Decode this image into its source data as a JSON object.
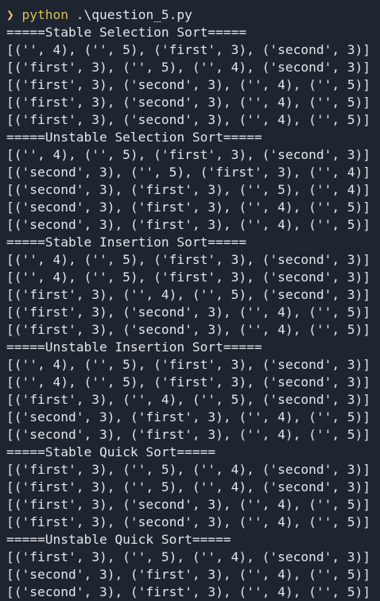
{
  "terminal": {
    "prompt": {
      "symbol": "❯",
      "command": "python",
      "argument": ".\\question_5.py"
    },
    "lines": [
      "=====Stable Selection Sort=====",
      "[('', 4), ('', 5), ('first', 3), ('second', 3)]",
      "[('first', 3), ('', 5), ('', 4), ('second', 3)]",
      "[('first', 3), ('second', 3), ('', 4), ('', 5)]",
      "[('first', 3), ('second', 3), ('', 4), ('', 5)]",
      "[('first', 3), ('second', 3), ('', 4), ('', 5)]",
      "=====Unstable Selection Sort=====",
      "[('', 4), ('', 5), ('first', 3), ('second', 3)]",
      "[('second', 3), ('', 5), ('first', 3), ('', 4)]",
      "[('second', 3), ('first', 3), ('', 5), ('', 4)]",
      "[('second', 3), ('first', 3), ('', 4), ('', 5)]",
      "[('second', 3), ('first', 3), ('', 4), ('', 5)]",
      "=====Stable Insertion Sort=====",
      "[('', 4), ('', 5), ('first', 3), ('second', 3)]",
      "[('', 4), ('', 5), ('first', 3), ('second', 3)]",
      "[('first', 3), ('', 4), ('', 5), ('second', 3)]",
      "[('first', 3), ('second', 3), ('', 4), ('', 5)]",
      "[('first', 3), ('second', 3), ('', 4), ('', 5)]",
      "=====Unstable Insertion Sort=====",
      "[('', 4), ('', 5), ('first', 3), ('second', 3)]",
      "[('', 4), ('', 5), ('first', 3), ('second', 3)]",
      "[('first', 3), ('', 4), ('', 5), ('second', 3)]",
      "[('second', 3), ('first', 3), ('', 4), ('', 5)]",
      "[('second', 3), ('first', 3), ('', 4), ('', 5)]",
      "=====Stable Quick Sort=====",
      "[('first', 3), ('', 5), ('', 4), ('second', 3)]",
      "[('first', 3), ('', 5), ('', 4), ('second', 3)]",
      "[('first', 3), ('second', 3), ('', 4), ('', 5)]",
      "[('first', 3), ('second', 3), ('', 4), ('', 5)]",
      "=====Unstable Quick Sort=====",
      "[('first', 3), ('', 5), ('', 4), ('second', 3)]",
      "[('second', 3), ('first', 3), ('', 4), ('', 5)]",
      "[('second', 3), ('first', 3), ('', 4), ('', 5)]"
    ]
  },
  "colors": {
    "background": "#1e2430",
    "text": "#e3e6ea",
    "prompt_symbol": "#e5c07b",
    "command": "#d4c15a"
  }
}
